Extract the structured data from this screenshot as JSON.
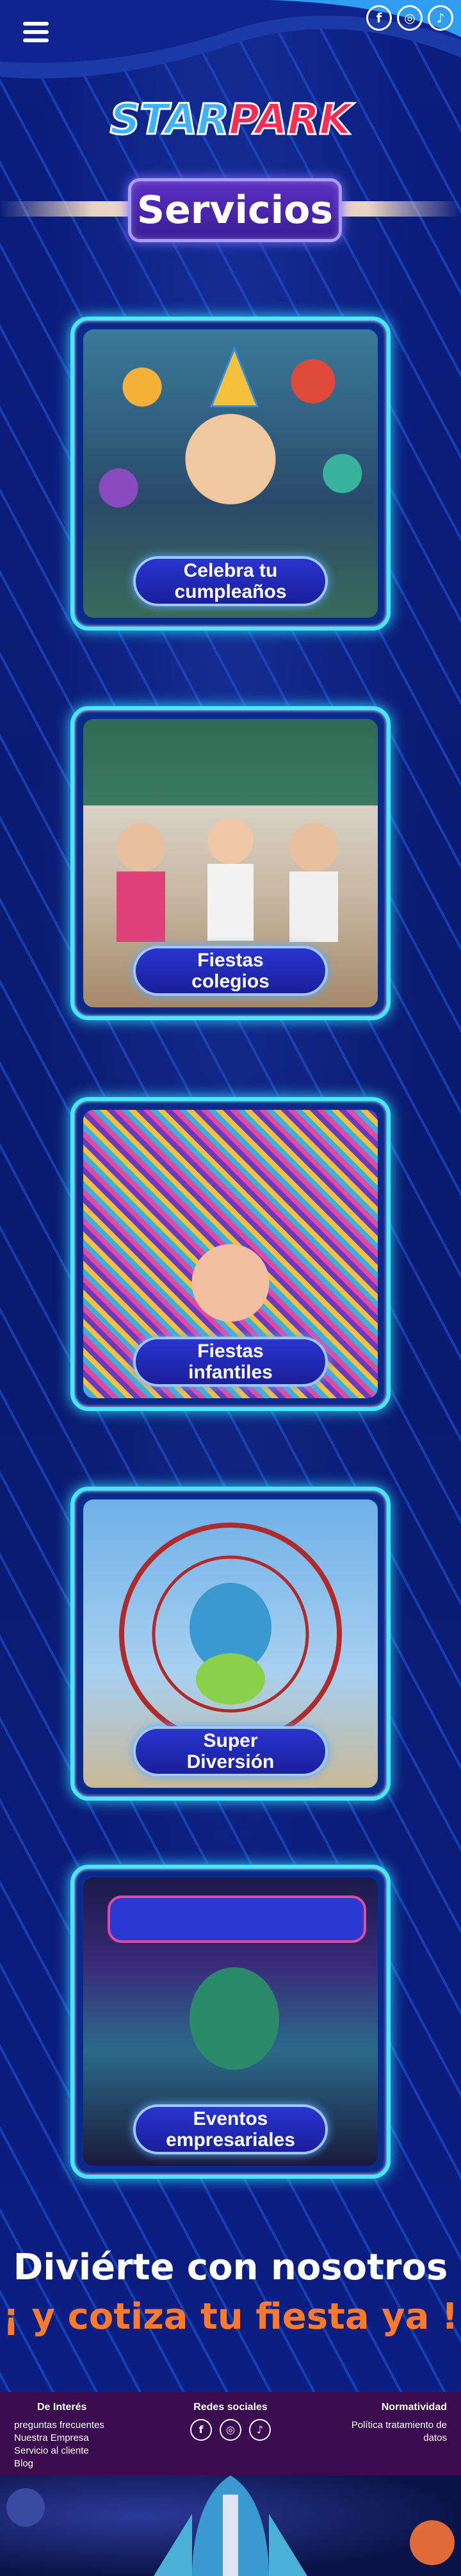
{
  "header": {
    "menu_icon": "hamburger-icon",
    "social": [
      {
        "name": "facebook-icon",
        "glyph": "f"
      },
      {
        "name": "instagram-icon",
        "glyph": "◎"
      },
      {
        "name": "tiktok-icon",
        "glyph": "♪"
      }
    ]
  },
  "logo": {
    "star": "STAR",
    "park": "PARK"
  },
  "page_title": "Servicios",
  "services": [
    {
      "label": "Celebra tu\ncumpleaños",
      "scene": "birthday"
    },
    {
      "label": "Fiestas\ncolegios",
      "scene": "school"
    },
    {
      "label": "Fiestas\ninfantiles",
      "scene": "party"
    },
    {
      "label": "Super\nDiversión",
      "scene": "fair"
    },
    {
      "label": "Eventos\nempresariales",
      "scene": "corporate"
    }
  ],
  "cta": {
    "line1": "Diviérte con nosotros",
    "line2": "¡ y cotiza tu fiesta ya !"
  },
  "footer": {
    "interest_title": "De Interés",
    "interest_links": [
      "preguntas frecuentes",
      "Nuestra Empresa",
      "Servicio al cliente",
      "Blog"
    ],
    "social_title": "Redes sociales",
    "legal_title": "Normatividad",
    "legal_links": [
      "Política tratamiento de datos"
    ]
  },
  "colors": {
    "background": "#0a1a72",
    "card_glow": "#46e8ff",
    "cta_orange": "#ff7a2a",
    "footer_bg": "#3a0b4e"
  }
}
